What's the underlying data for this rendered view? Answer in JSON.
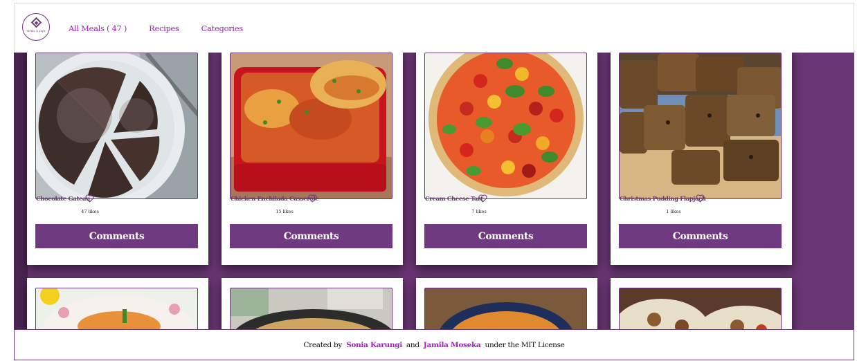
{
  "header": {
    "logo_text": "Meals & Dips",
    "nav": [
      {
        "label": "All Meals ( 47 )"
      },
      {
        "label": "Recipes"
      },
      {
        "label": "Categories"
      }
    ]
  },
  "meals_top": [
    {
      "title": "Chocolate Gateau",
      "likes": "47 likes",
      "comments_label": "Comments"
    },
    {
      "title": "Chicken Enchilada Casserole",
      "likes": "15 likes",
      "comments_label": "Comments"
    },
    {
      "title": "Cream Cheese Tart",
      "likes": "7 likes",
      "comments_label": "Comments"
    },
    {
      "title": "Christmas Pudding Flapjack",
      "likes": "1 likes",
      "comments_label": "Comments"
    }
  ],
  "footer": {
    "created_by": "Created by",
    "author1": "Sonia Karungi",
    "and": "and",
    "author2": "Jamila Moseka",
    "license": "under the MIT License"
  },
  "colors": {
    "purple": "#6b3675",
    "link": "#a020c0"
  }
}
